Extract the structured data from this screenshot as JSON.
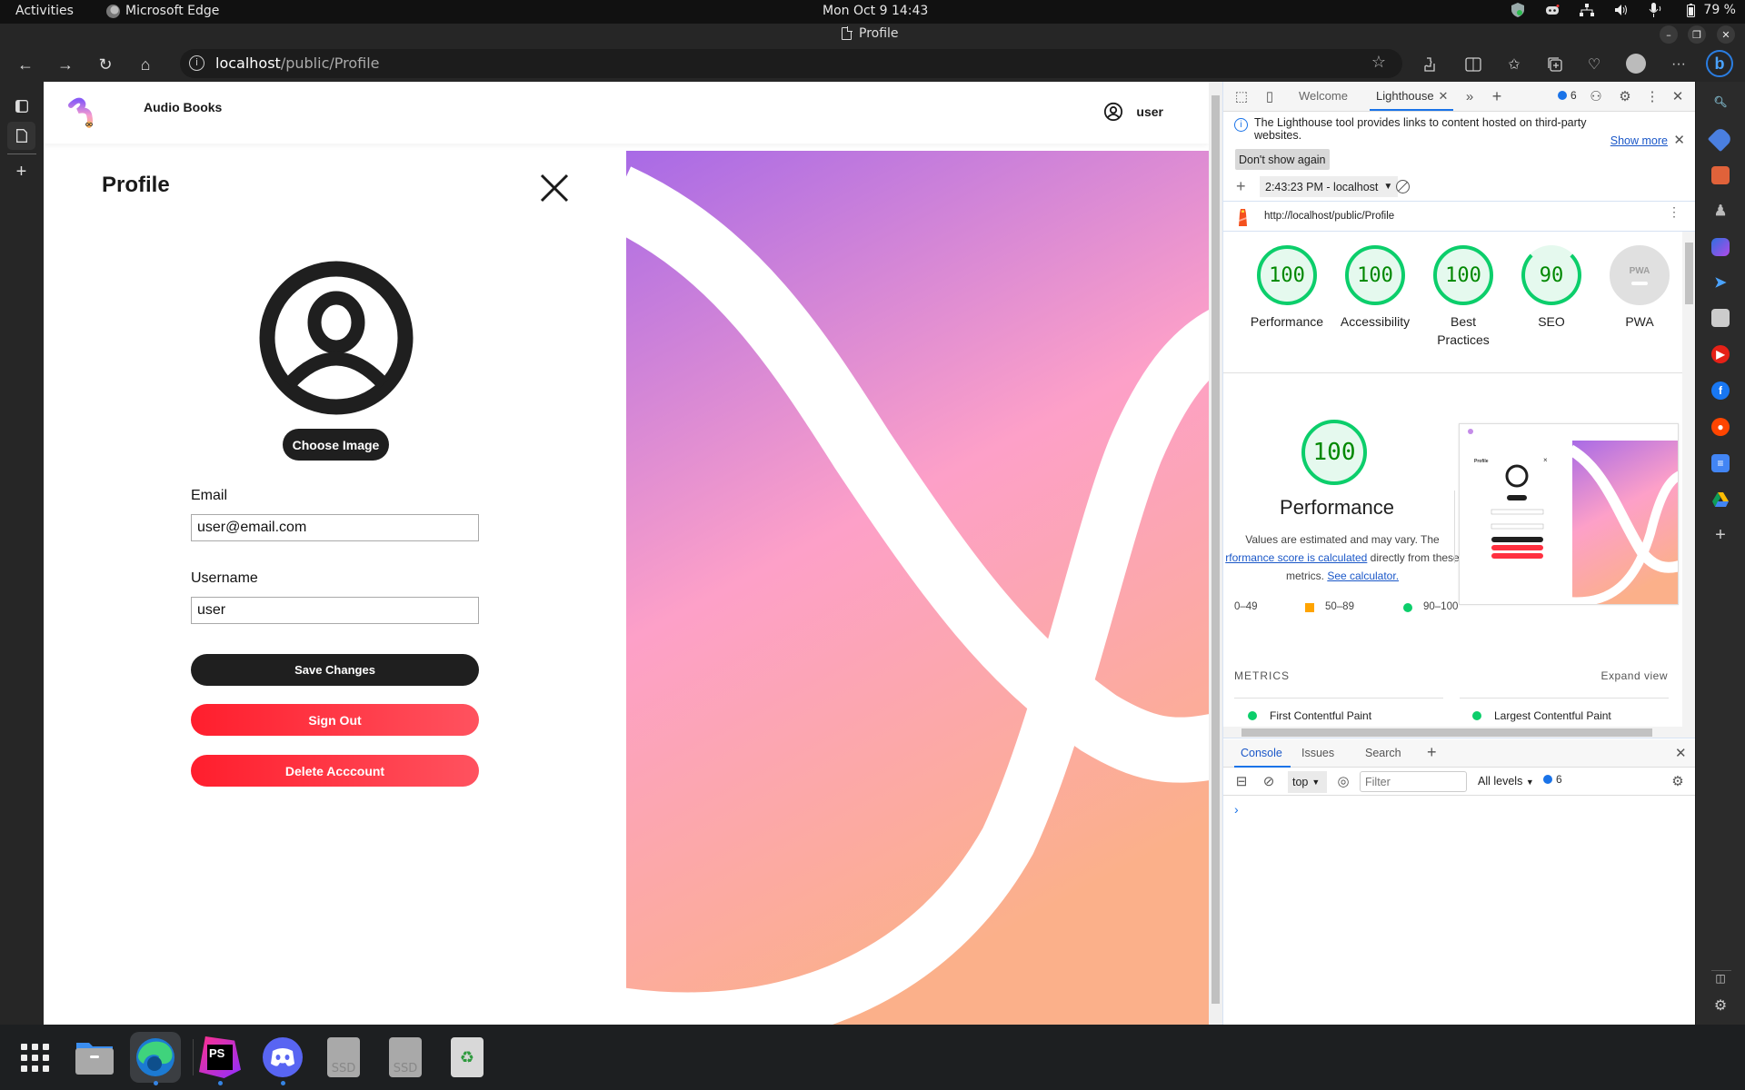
{
  "system": {
    "activities": "Activities",
    "app_name": "Microsoft Edge",
    "clock": "Mon Oct 9  14:43",
    "battery": "79 %",
    "tray_icons": [
      "shield-icon",
      "discord-icon",
      "network-icon",
      "volume-icon",
      "microphone-icon",
      "battery-icon"
    ]
  },
  "browser": {
    "window_title": "Profile",
    "url_host": "localhost",
    "url_path": "/public/Profile",
    "toolbar_icons": [
      "favorite-star-icon",
      "extensions-icon",
      "split-screen-icon",
      "favorites-icon",
      "collections-icon",
      "browser-essentials-icon",
      "profile-avatar",
      "more-icon",
      "bing-copilot-icon"
    ],
    "vertical_tabs": [
      "tab-actions-icon",
      "page-tab-icon",
      "new-tab-icon"
    ]
  },
  "app": {
    "brand": "Audio Books",
    "user_label": "user",
    "profile_title": "Profile",
    "choose_image": "Choose Image",
    "email_label": "Email",
    "email_value": "user@email.com",
    "username_label": "Username",
    "username_value": "user",
    "save_changes": "Save Changes",
    "sign_out": "Sign Out",
    "delete_account": "Delete Acccount",
    "colors": {
      "primary_dark": "#1f1f1f",
      "danger_start": "#ff1e2d",
      "danger_end": "#ff525f",
      "hero_top": "#a86ae6",
      "hero_mid": "#fda0c8",
      "hero_bottom": "#fbb08a"
    }
  },
  "devtools": {
    "tabs": [
      "Welcome",
      "Lighthouse"
    ],
    "active_tab": "Lighthouse",
    "message_count": "6",
    "info_text": "The Lighthouse tool provides links to content hosted on third-party websites.",
    "show_more": "Show more",
    "dont_show_again": "Don't show again",
    "report_select": "2:43:23 PM - localhost",
    "report_url": "http://localhost/public/Profile",
    "scores": [
      {
        "label": "Performance",
        "score": 100
      },
      {
        "label": "Accessibility",
        "score": 100
      },
      {
        "label": "Best Practices",
        "score": 100
      },
      {
        "label": "SEO",
        "score": 90
      },
      {
        "label": "PWA",
        "score": null
      }
    ],
    "pwa_badge": "PWA",
    "performance": {
      "score": "100",
      "title": "Performance",
      "desc_1": "Values are estimated and may vary. The",
      "desc_link": "rformance score is calculated",
      "desc_2": " directly from these",
      "desc_3": "metrics. ",
      "calc_link": "See calculator."
    },
    "legend": {
      "low": "0–49",
      "mid": "50–89",
      "high": "90–100"
    },
    "metrics_heading": "METRICS",
    "expand_view": "Expand view",
    "metrics": [
      "First Contentful Paint",
      "Largest Contentful Paint"
    ],
    "drawer_tabs": [
      "Console",
      "Issues",
      "Search"
    ],
    "active_drawer_tab": "Console",
    "context": "top",
    "filter_placeholder": "Filter",
    "levels": "All levels",
    "console_msg_count": "6",
    "prompt": "›"
  },
  "sidebar": {
    "items": [
      "search-icon",
      "shopping-tag-icon",
      "tools-icon",
      "games-icon",
      "microsoft-365-icon",
      "outlook-send-icon",
      "qr-icon",
      "youtube-icon",
      "facebook-icon",
      "reddit-icon",
      "docs-icon",
      "google-drive-icon",
      "add-icon"
    ]
  },
  "taskbar": {
    "items": [
      "app-grid",
      "files",
      "microsoft-edge",
      "phpstorm",
      "discord",
      "ssd-drive-1",
      "ssd-drive-2",
      "trash"
    ],
    "ssd_label": "SSD",
    "phpstorm_label": "PS"
  }
}
